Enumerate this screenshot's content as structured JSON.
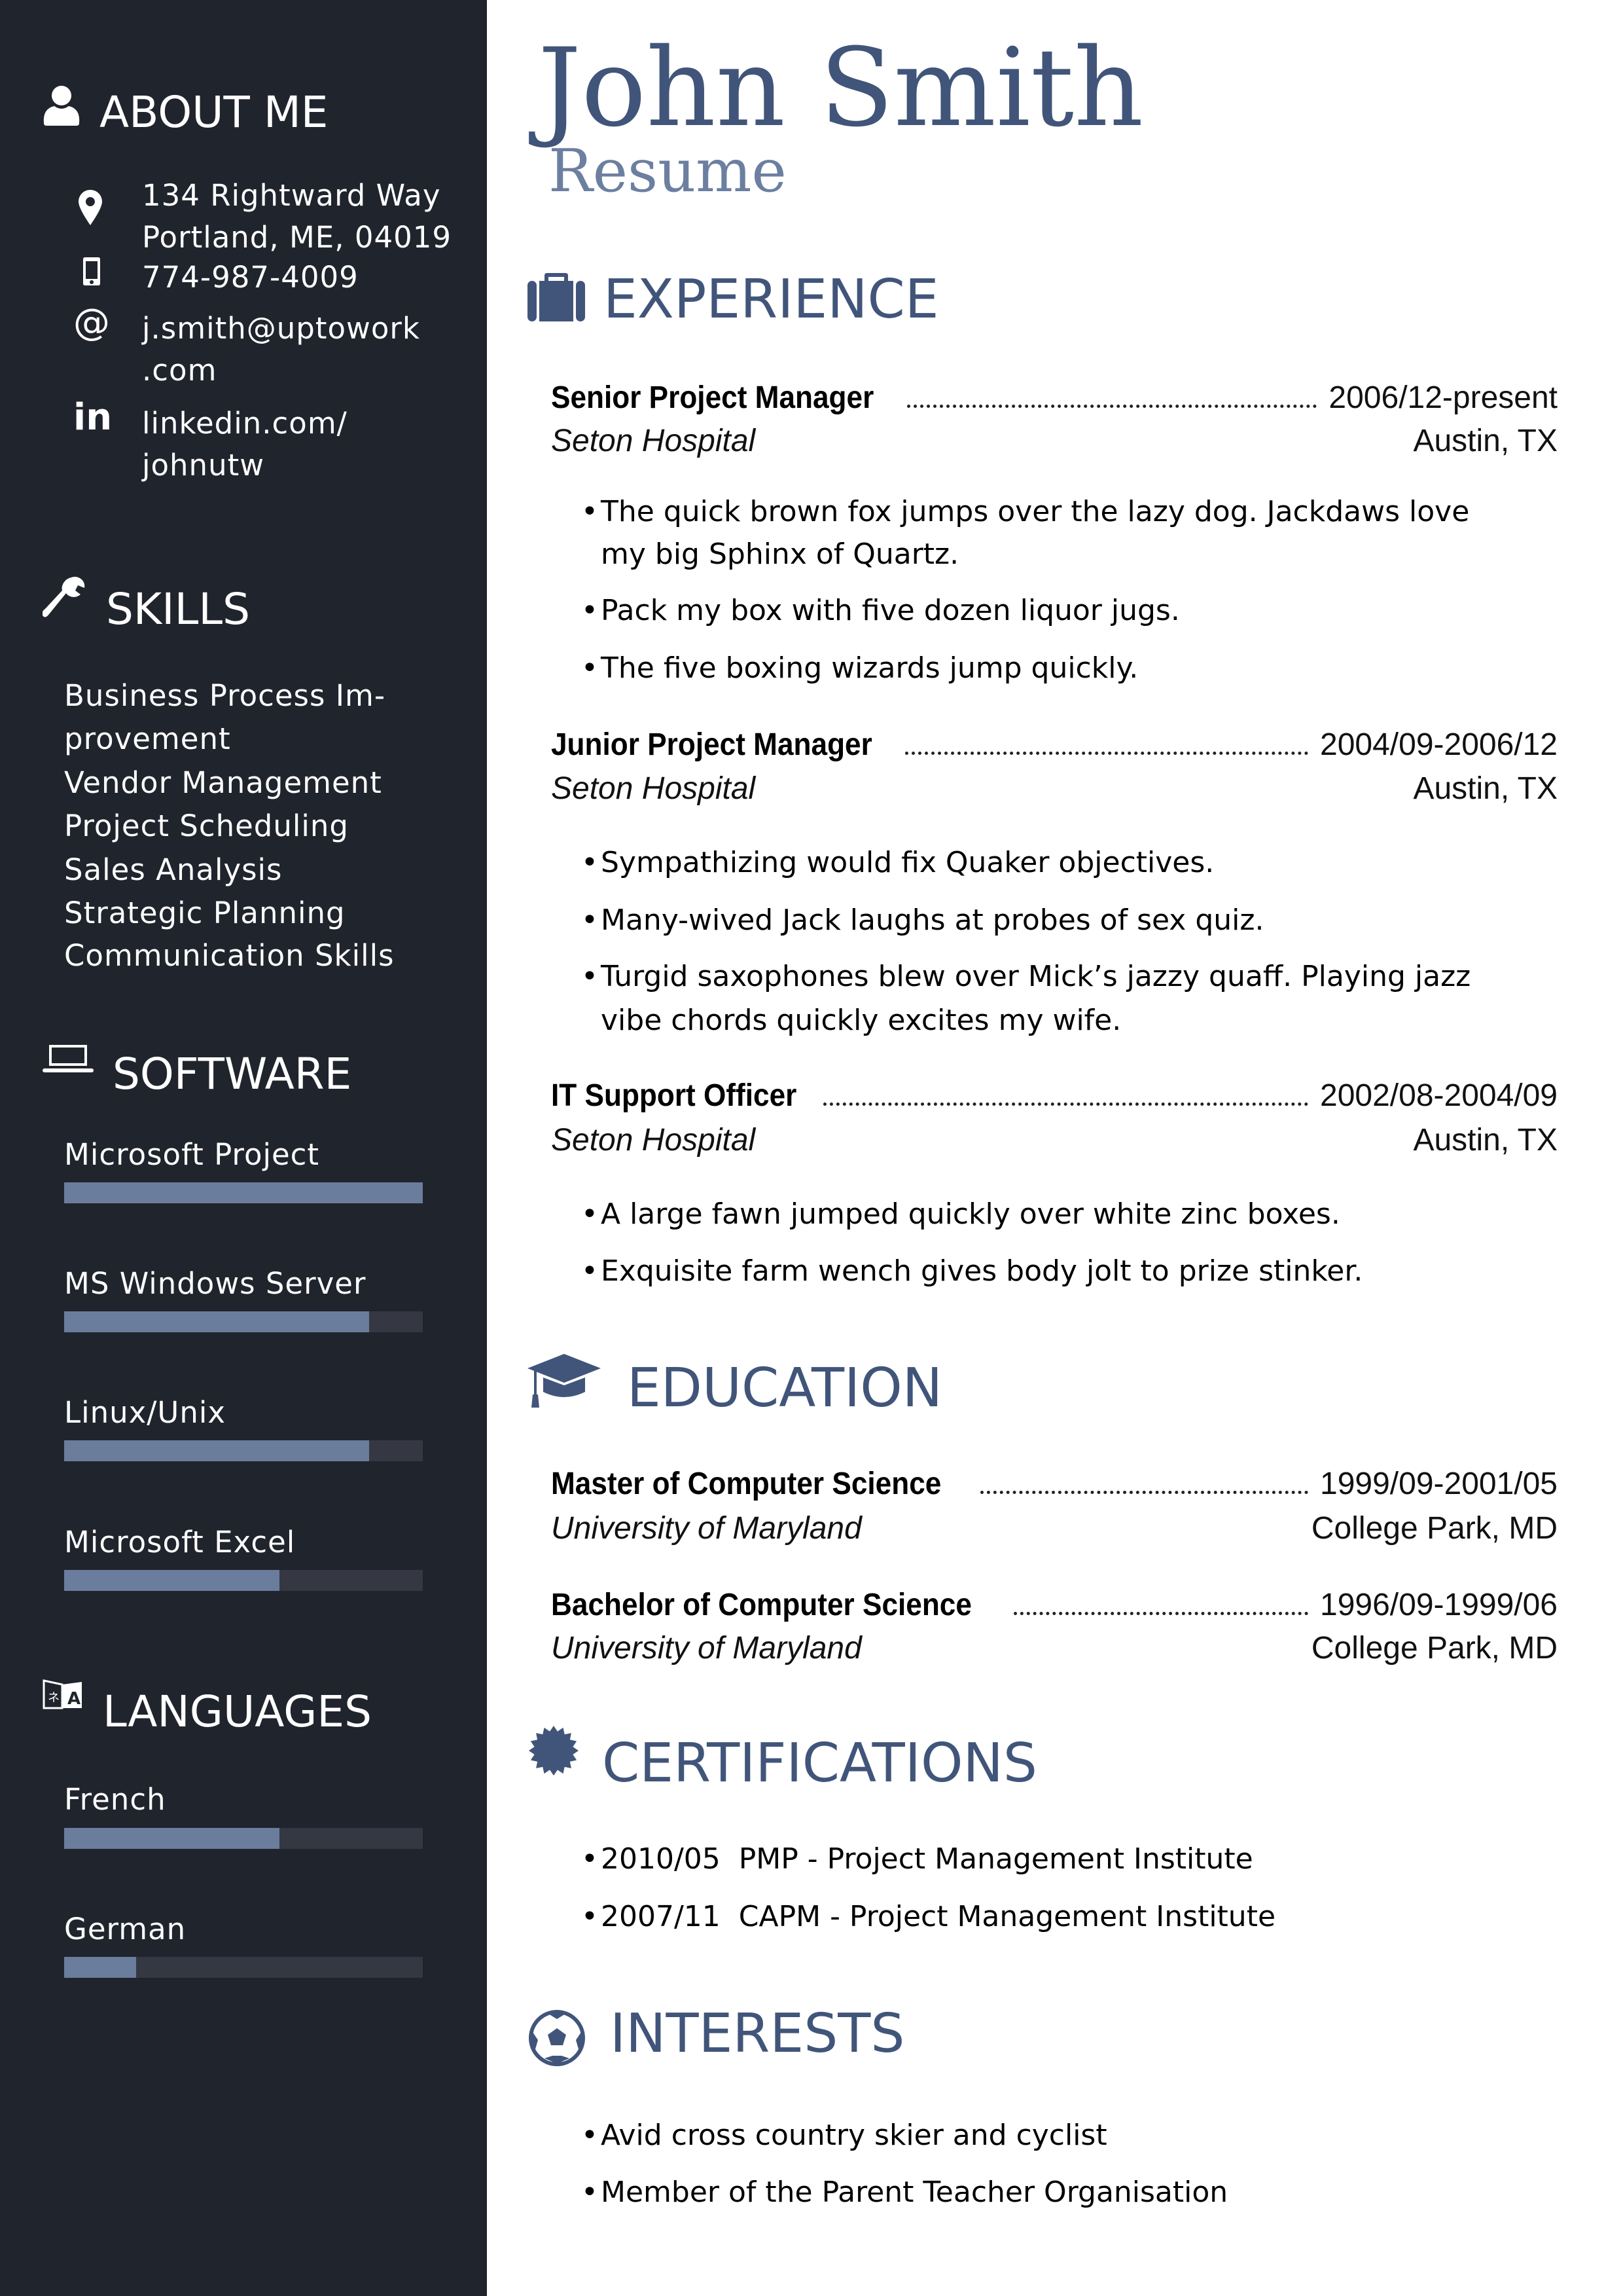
{
  "header": {
    "name": "John Smith",
    "subtitle": "Resume"
  },
  "colors": {
    "sidebar_bg": "#20242c",
    "accent": "#41557a",
    "accent_light": "#6c7fa0",
    "bar_fill": "#6b7d9c",
    "bar_track": "#353842"
  },
  "about": {
    "heading": "ABOUT ME",
    "address_line1": "134 Rightward Way",
    "address_line2": "Portland, ME, 04019",
    "phone": "774-987-4009",
    "email_line1": "j.smith@uptowork",
    "email_line2": ".com",
    "linkedin_line1": "linkedin.com/",
    "linkedin_line2": "johnutw"
  },
  "skills": {
    "heading": "SKILLS",
    "lines": [
      "Business Process Im-",
      "provement",
      "Vendor Management",
      "Project Scheduling",
      "Sales Analysis",
      "Strategic Planning",
      "Communication Skills"
    ]
  },
  "software": {
    "heading": "SOFTWARE",
    "items": [
      {
        "label": "Microsoft Project",
        "level": 1.0
      },
      {
        "label": "MS Windows Server",
        "level": 0.85
      },
      {
        "label": "Linux/Unix",
        "level": 0.85
      },
      {
        "label": "Microsoft Excel",
        "level": 0.6
      }
    ]
  },
  "languages": {
    "heading": "LANGUAGES",
    "items": [
      {
        "label": "French",
        "level": 0.6
      },
      {
        "label": "German",
        "level": 0.2
      }
    ]
  },
  "experience": {
    "heading": "EXPERIENCE",
    "jobs": [
      {
        "title": "Senior Project Manager",
        "dates": "2006/12-present",
        "org": "Seton Hospital",
        "location": "Austin, TX",
        "bullets": [
          [
            "The quick brown fox jumps over the lazy dog.  Jackdaws love",
            "my big Sphinx of Quartz."
          ],
          [
            "Pack my box with five dozen liquor jugs."
          ],
          [
            "The five boxing wizards jump quickly."
          ]
        ]
      },
      {
        "title": "Junior Project Manager",
        "dates": "2004/09-2006/12",
        "org": "Seton Hospital",
        "location": "Austin, TX",
        "bullets": [
          [
            "Sympathizing would fix Quaker objectives."
          ],
          [
            "Many-wived Jack laughs at probes of sex quiz."
          ],
          [
            "Turgid saxophones blew over Mick’s jazzy quaff.  Playing jazz",
            "vibe chords quickly excites my wife."
          ]
        ]
      },
      {
        "title": "IT Support Officer",
        "dates": "2002/08-2004/09",
        "org": "Seton Hospital",
        "location": "Austin, TX",
        "bullets": [
          [
            "A large fawn jumped quickly over white zinc boxes."
          ],
          [
            "Exquisite farm wench gives body jolt to prize stinker."
          ]
        ]
      }
    ]
  },
  "education": {
    "heading": "EDUCATION",
    "degrees": [
      {
        "title": "Master of Computer Science",
        "dates": "1999/09-2001/05",
        "org": "University of Maryland",
        "location": "College Park, MD"
      },
      {
        "title": "Bachelor of Computer Science",
        "dates": "1996/09-1999/06",
        "org": "University of Maryland",
        "location": "College Park, MD"
      }
    ]
  },
  "certifications": {
    "heading": "CERTIFICATIONS",
    "items": [
      "2010/05  PMP - Project Management Institute",
      "2007/11  CAPM - Project Management Institute"
    ]
  },
  "interests": {
    "heading": "INTERESTS",
    "items": [
      "Avid cross country skier and cyclist",
      "Member of the Parent Teacher Organisation"
    ]
  }
}
